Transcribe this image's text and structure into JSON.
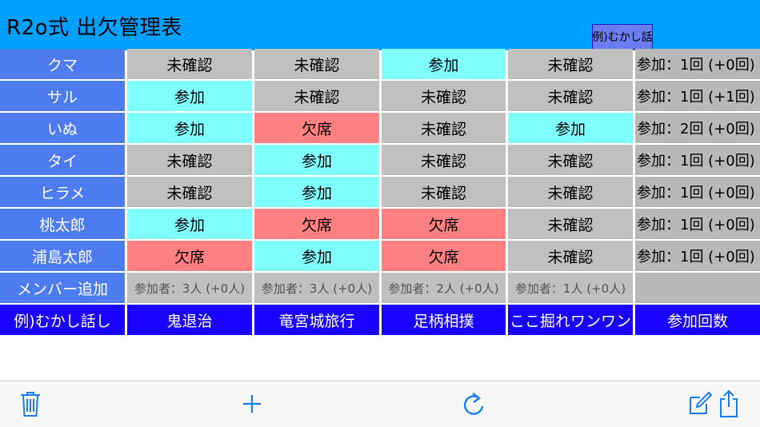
{
  "header": {
    "title": "R2o式 出欠管理表",
    "example_button": "例)むかし話"
  },
  "colors": {
    "header": "#00a0ff",
    "name": "#4d7cf0",
    "footer": "#1a00ff",
    "attend": "#80ffff",
    "absent": "#ff8080",
    "unconfirmed": "#c0c0c0",
    "toolbar_icon": "#1a7cf0"
  },
  "members": [
    {
      "name": "クマ",
      "statuses": [
        "未確認",
        "未確認",
        "参加",
        "未確認"
      ],
      "summary": "参加：1回 (+0回)"
    },
    {
      "name": "サル",
      "statuses": [
        "参加",
        "未確認",
        "未確認",
        "未確認"
      ],
      "summary": "参加：1回 (+1回)"
    },
    {
      "name": "いぬ",
      "statuses": [
        "参加",
        "欠席",
        "未確認",
        "参加"
      ],
      "summary": "参加：2回 (+0回)"
    },
    {
      "name": "タイ",
      "statuses": [
        "未確認",
        "参加",
        "未確認",
        "未確認"
      ],
      "summary": "参加：1回 (+0回)"
    },
    {
      "name": "ヒラメ",
      "statuses": [
        "未確認",
        "参加",
        "未確認",
        "未確認"
      ],
      "summary": "参加：1回 (+0回)"
    },
    {
      "name": "桃太郎",
      "statuses": [
        "参加",
        "欠席",
        "欠席",
        "未確認"
      ],
      "summary": "参加：1回 (+0回)"
    },
    {
      "name": "浦島太郎",
      "statuses": [
        "欠席",
        "参加",
        "欠席",
        "未確認"
      ],
      "summary": "参加：1回 (+0回)"
    }
  ],
  "add_member_row": {
    "label": "メンバー追加",
    "counts": [
      "参加者：3人 (+0人)",
      "参加者：3人 (+0人)",
      "参加者：2人 (+0人)",
      "参加者：1人 (+0人)"
    ]
  },
  "footer_row": {
    "label": "例)むかし話し",
    "events": [
      "鬼退治",
      "竜宮城旅行",
      "足柄相撲",
      "ここ掘れワンワン"
    ],
    "count_label": "参加回数"
  },
  "toolbar": {
    "icons": [
      "trash-icon",
      "plus-icon",
      "refresh-icon",
      "compose-icon",
      "share-icon"
    ]
  }
}
